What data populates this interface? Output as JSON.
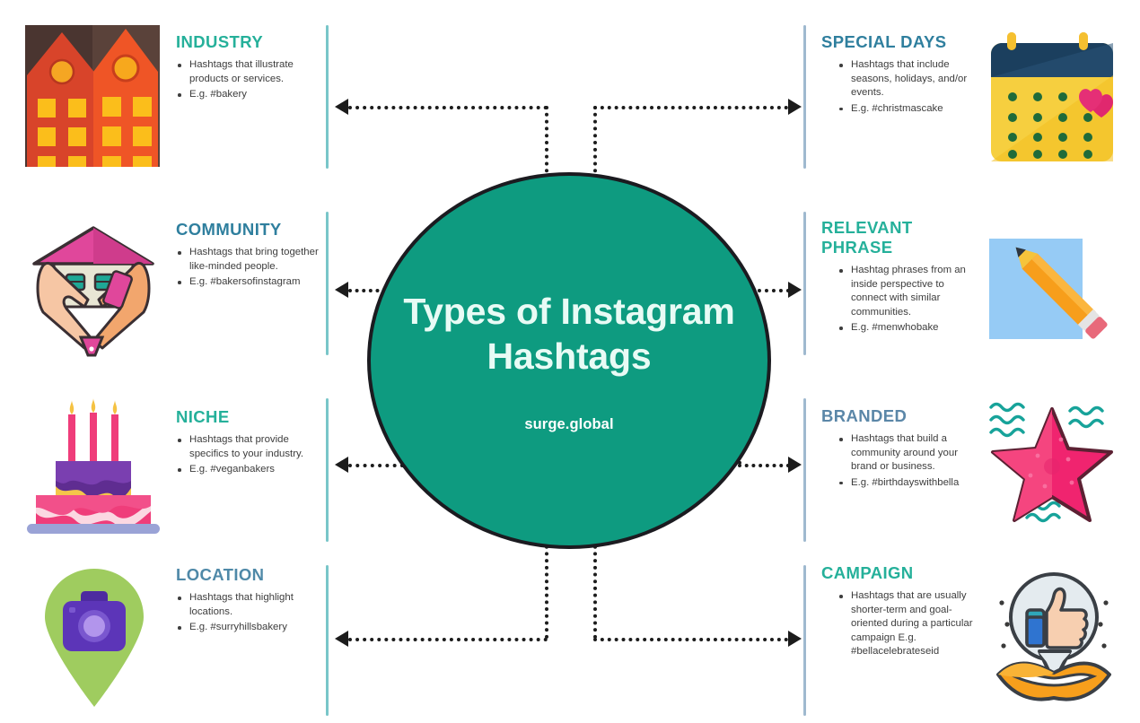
{
  "center": {
    "title_line1": "Types of Instagram",
    "title_line2": "Hashtags",
    "brand": "surge.global",
    "fill": "#0e9b80",
    "border": "#1b1b20",
    "title_color": "#e8fbf5"
  },
  "colors": {
    "rule_left": "#79c6c9",
    "rule_right": "#9fb9cf",
    "connector": "#1c1c1c",
    "body_text": "#3d3d3d",
    "heading_teal": "#25b09a",
    "heading_blue": "#2f7f9e",
    "heading_steel": "#5b87a8"
  },
  "left_items": [
    {
      "id": "industry",
      "heading": "INDUSTRY",
      "heading_color": "#25b09a",
      "icon": "buildings-icon",
      "bullets": [
        "Hashtags that illustrate products or services.",
        "E.g. #bakery"
      ]
    },
    {
      "id": "community",
      "heading": "COMMUNITY",
      "heading_color": "#2f7f9e",
      "icon": "hands-house-icon",
      "bullets": [
        "Hashtags that bring together like-minded people.",
        "E.g. #bakersofinstagram"
      ]
    },
    {
      "id": "niche",
      "heading": "NICHE",
      "heading_color": "#25b09a",
      "icon": "birthday-cake-icon",
      "bullets": [
        "Hashtags that provide specifics to your industry.",
        "E.g. #veganbakers"
      ]
    },
    {
      "id": "location",
      "heading": "LOCATION",
      "heading_color": "#4f89a8",
      "icon": "map-pin-camera-icon",
      "bullets": [
        "Hashtags that highlight locations.",
        "E.g. #surryhillsbakery"
      ]
    }
  ],
  "right_items": [
    {
      "id": "special-days",
      "heading": "SPECIAL DAYS",
      "heading_color": "#2f7f9e",
      "icon": "calendar-heart-icon",
      "bullets": [
        "Hashtags that include seasons, holidays, and/or events.",
        "E.g. #christmascake"
      ]
    },
    {
      "id": "relevant-phrase",
      "heading": "RELEVANT PHRASE",
      "heading_color": "#25b09a",
      "icon": "pencil-note-icon",
      "bullets": [
        "Hashtag phrases from an inside perspective to connect with similar communities.",
        "E.g. #menwhobake"
      ]
    },
    {
      "id": "branded",
      "heading": "BRANDED",
      "heading_color": "#5b87a8",
      "icon": "starfish-icon",
      "bullets": [
        "Hashtags that build a community around your brand or business.",
        "E.g. #birthdayswithbella"
      ]
    },
    {
      "id": "campaign",
      "heading": "CAMPAIGN",
      "heading_color": "#25b09a",
      "icon": "lips-thumbsup-icon",
      "bullets": [
        "Hashtags that are usually shorter-term and goal-oriented during a particular campaign E.g. #bellacelebrateseid"
      ]
    }
  ]
}
